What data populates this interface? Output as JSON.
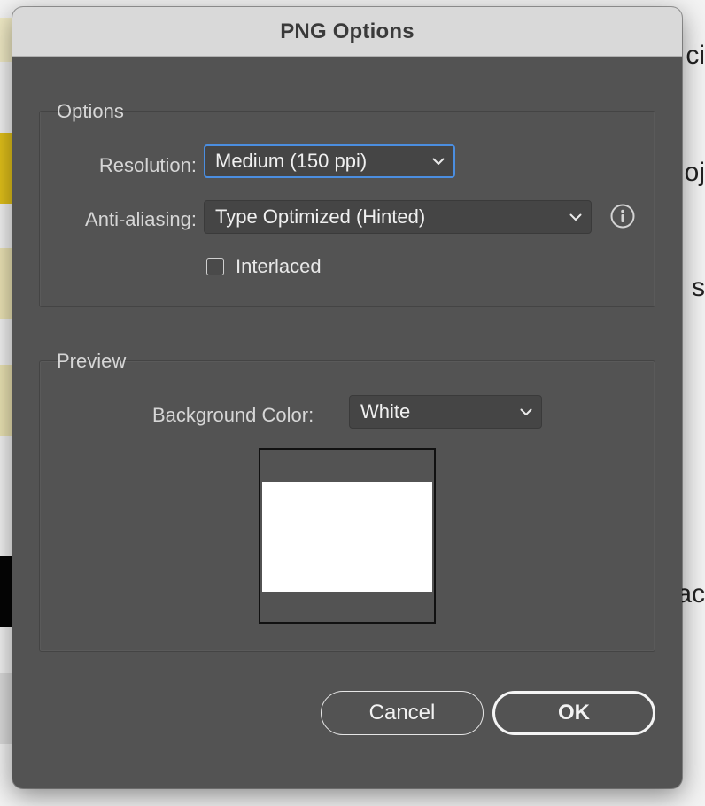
{
  "dialog": {
    "title": "PNG Options"
  },
  "options_group": {
    "label": "Options",
    "resolution": {
      "label": "Resolution:",
      "value": "Medium (150 ppi)"
    },
    "anti_aliasing": {
      "label": "Anti-aliasing:",
      "value": "Type Optimized (Hinted)",
      "info_icon": "info-icon"
    },
    "interlaced": {
      "label": "Interlaced",
      "checked": false
    }
  },
  "preview_group": {
    "label": "Preview",
    "background_color": {
      "label": "Background Color:",
      "value": "White",
      "swatch_hex": "#ffffff"
    }
  },
  "buttons": {
    "cancel_label": "Cancel",
    "ok_label": "OK"
  },
  "background_fragments": [
    "ci",
    "oj",
    "s",
    "ac"
  ],
  "colors": {
    "dialog_bg": "#535353",
    "titlebar_bg": "#d9d9d9",
    "focus_ring": "#4b8ee0"
  }
}
